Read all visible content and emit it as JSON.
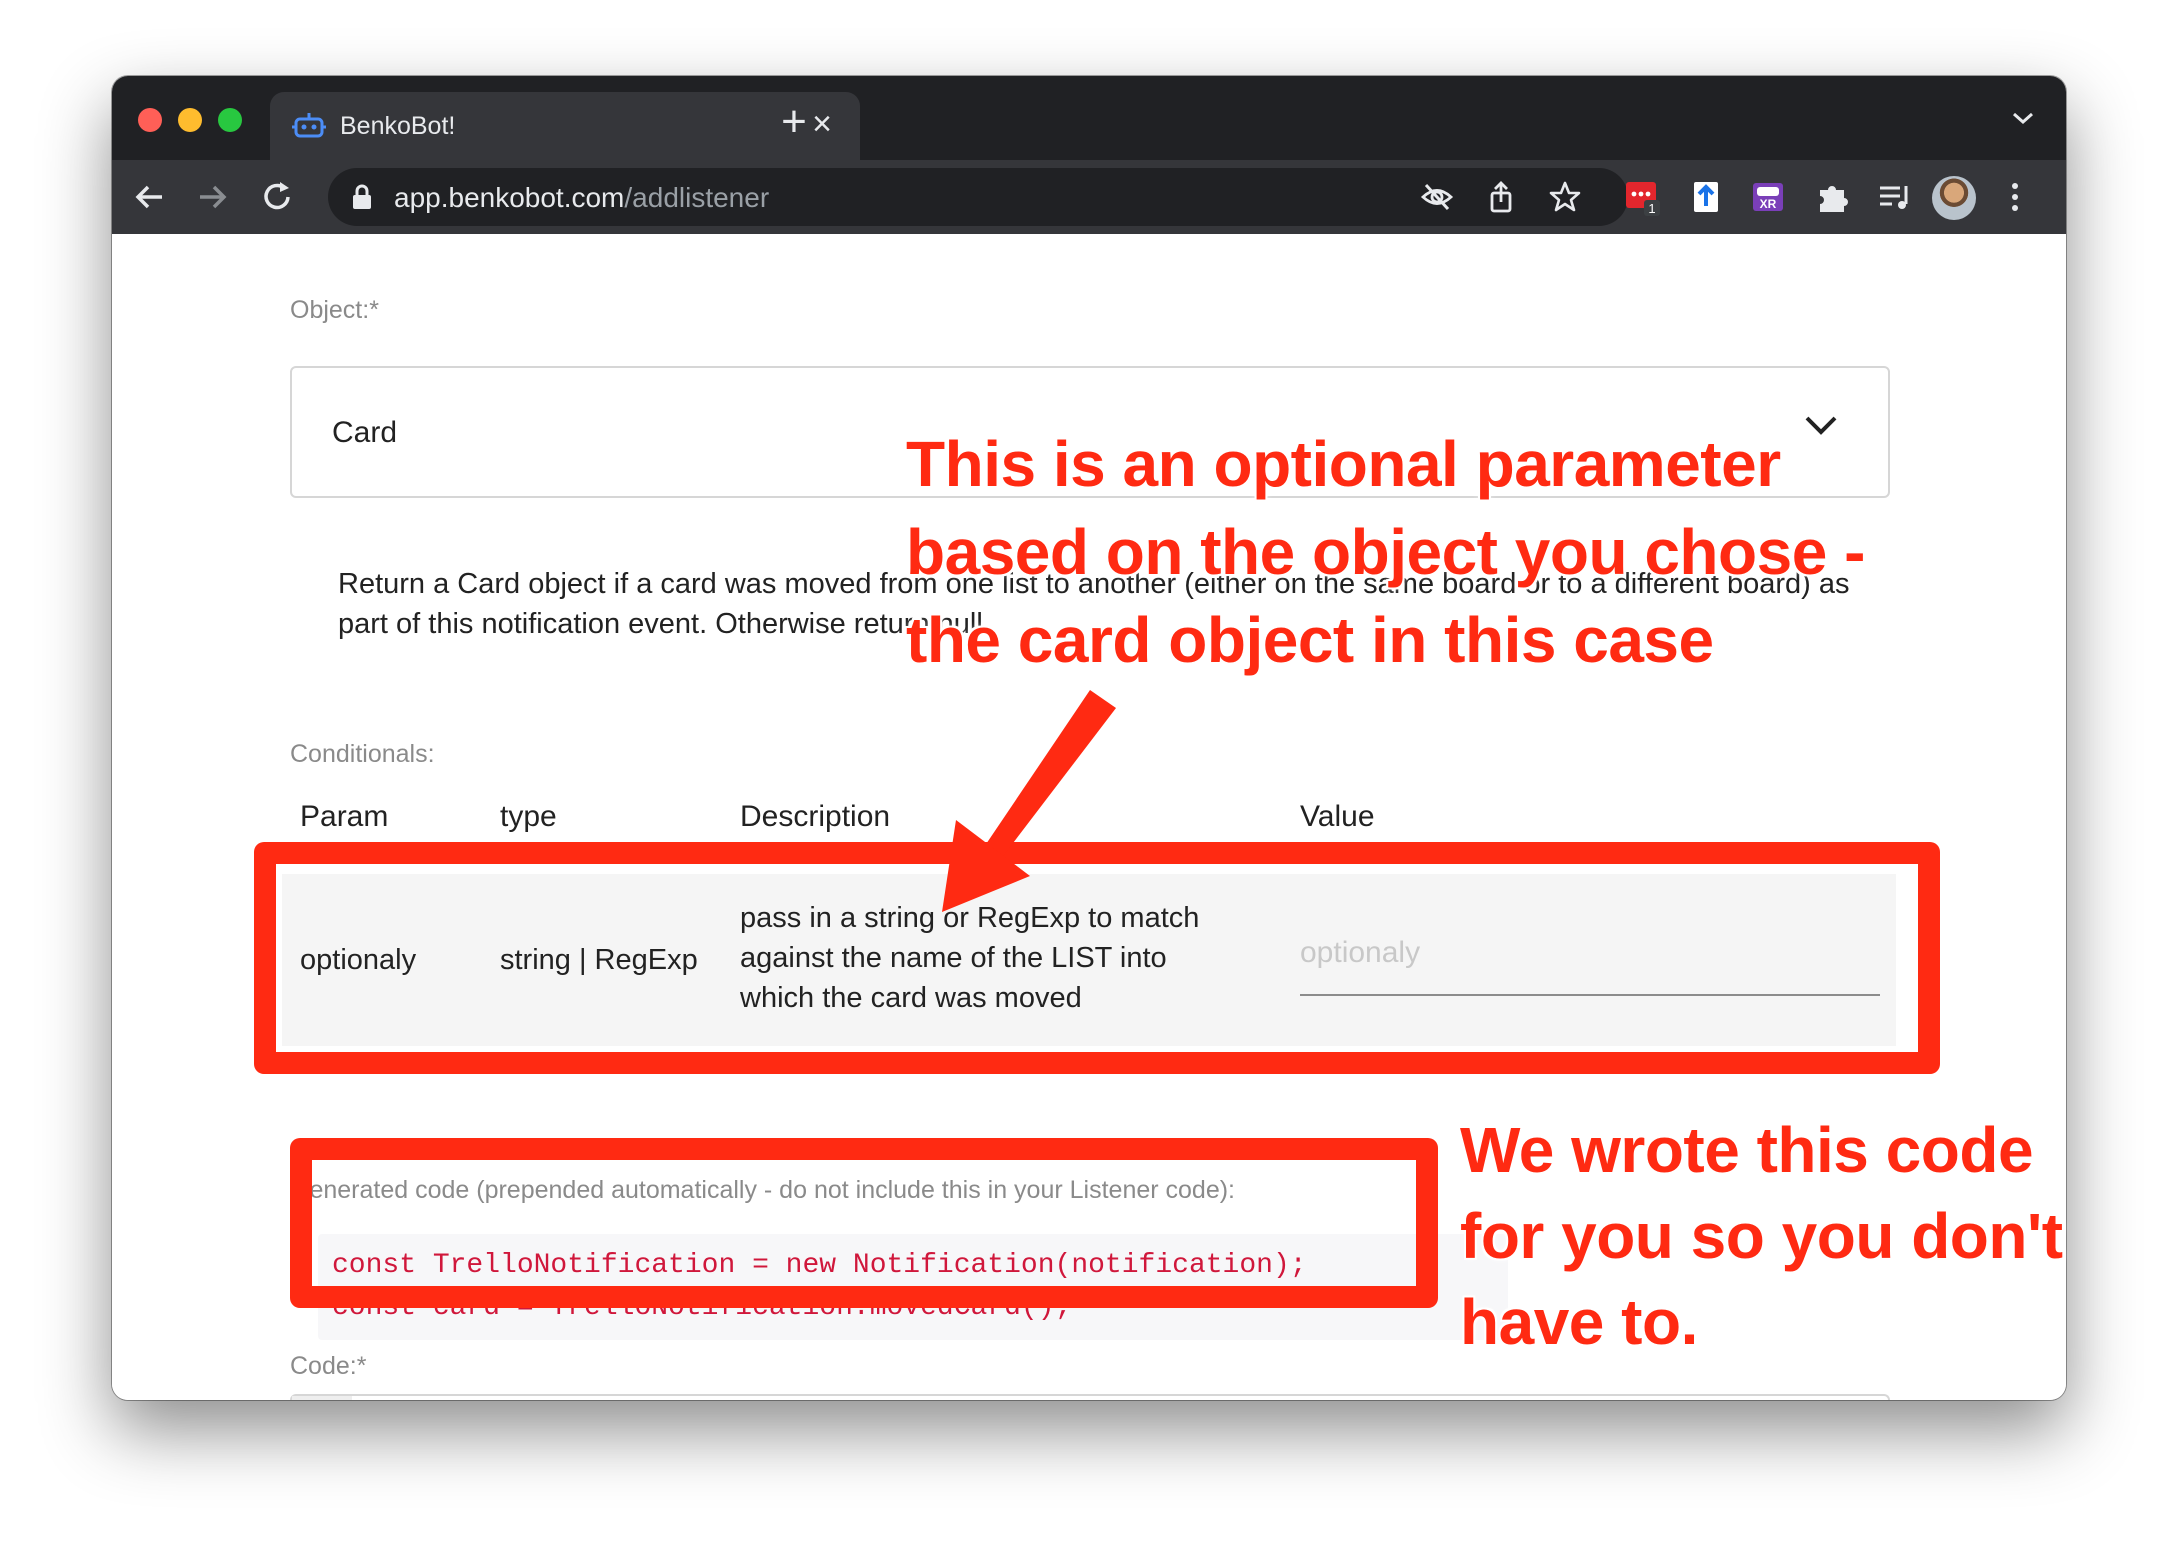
{
  "browser": {
    "tab_title": "BenkoBot!",
    "tab_close": "×",
    "new_tab": "+",
    "url_host": "app.benkobot.com",
    "url_path": "/addlistener",
    "extension_badge": "1"
  },
  "form": {
    "object_label": "Object:*",
    "object_value": "Card",
    "object_description": "Return a Card object if a card was moved from one list to another (either on the same board or to a different board) as part of this notification event. Otherwise return null.",
    "conditionals_label": "Conditionals:",
    "table": {
      "headers": [
        "Param",
        "type",
        "Description",
        "Value"
      ],
      "row": {
        "param": "optionaly",
        "type": "string | RegExp",
        "description_lines": [
          "pass in a string or RegExp to match",
          "against the name of the LIST into",
          "which the card was moved"
        ],
        "value_placeholder": "optionaly"
      }
    },
    "generated_code_label": "Generated code (prepended automatically - do not include this in your Listener code):",
    "code_lines": [
      "const TrelloNotification = new Notification(notification);",
      "const card = TrelloNotification.movedCard();"
    ],
    "code_label": "Code:*"
  },
  "annotations": {
    "callout_top_lines": [
      "This is an optional parameter",
      "based on the object you chose -",
      "the card object in this case"
    ],
    "callout_right_lines": [
      "We wrote this code",
      "for you so you don't",
      "have to."
    ],
    "color": "#ff2a12"
  }
}
